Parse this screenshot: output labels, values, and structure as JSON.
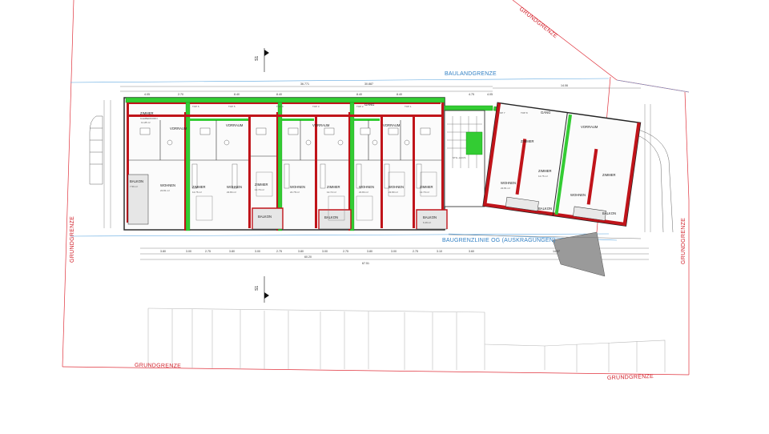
{
  "labels": {
    "grundgrenze": "GRUNDGRENZE",
    "baulandgrenze": "BAULANDGRENZE",
    "baugrenzlinie": "BAUGRENZLINIE OG (AUSKRAGUNGEN)",
    "section": "S1"
  },
  "dimensions": {
    "top_total_a": "36.771",
    "top_total_b": "30.887",
    "right_total": "14.06",
    "bottom_total_a": "60.20",
    "bottom_total_b": "67.51",
    "top_segments": [
      "4.05",
      "2.70",
      "8.40",
      "8.40",
      "8.40",
      "8.40",
      "4.75",
      "4.05"
    ],
    "bottom_segments": [
      "3.80",
      "3.00",
      "2.75",
      "3.80",
      "3.00",
      "2.75",
      "3.80",
      "3.00",
      "2.75",
      "3.80",
      "3.00",
      "2.75",
      "3.10",
      "3.60",
      "14.97"
    ]
  },
  "rooms": {
    "zimmer": "ZIMMER",
    "wohnen": "WOHNEN",
    "vorraum": "VORRAUM",
    "balkon": "BALKON",
    "gang": "GANG",
    "kleinerdorn": "KLEIBERDORN",
    "tops": [
      "TOP 6",
      "TOP 5",
      "TOP 4",
      "TOP 3",
      "TOP 2",
      "TOP 1",
      "TOP 7",
      "TOP 8"
    ],
    "stgh": "STG.-HAUS",
    "units": [
      {
        "zimmer_area": "11.28 m²",
        "wohnen_area": "22.81 m²",
        "balkon_area": "7.56 m²"
      },
      {
        "zimmer_area": "12.76 m²",
        "wohnen_area": "22.84 m²",
        "balkon_area": "6.49 m²"
      },
      {
        "zimmer_area": "12.70 m²",
        "wohnen_area": "22.78 m²",
        "balkon_area": "6.49 m²"
      },
      {
        "zimmer_area": "12.72 m²",
        "wohnen_area": "22.84 m²",
        "balkon_area": "6.49 m²"
      },
      {
        "zimmer_area": "12.70 m²",
        "wohnen_area": "22.80 m²",
        "balkon_area": "6.49 m²"
      },
      {
        "zimmer_area": "12.76 m²",
        "wohnen_area": "22.81 m²",
        "balkon_area": "6.49 m²"
      }
    ]
  }
}
